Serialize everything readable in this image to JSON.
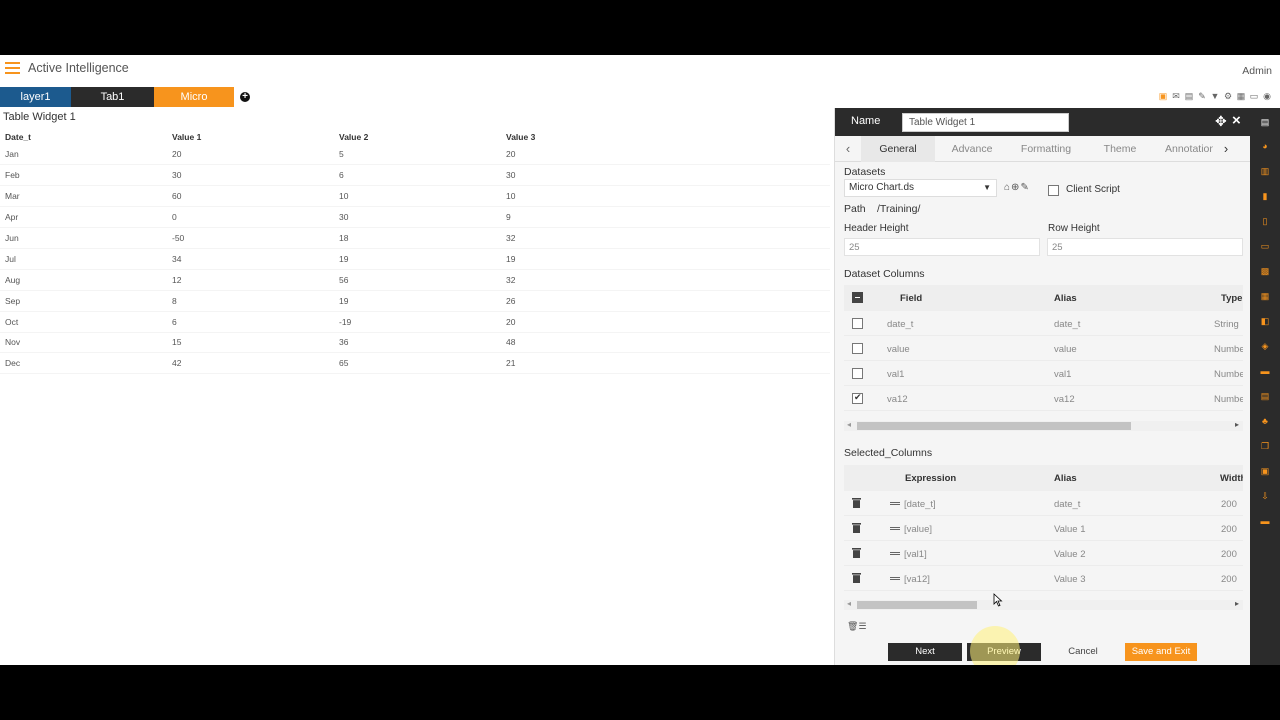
{
  "app": {
    "title": "Active Intelligence",
    "user": "Admin"
  },
  "tabs": [
    {
      "label": "layer1",
      "color": "#1c5a8e"
    },
    {
      "label": "Tab1",
      "color": "#2b2b2b"
    },
    {
      "label": "Micro",
      "color": "#f7941d"
    }
  ],
  "widget": {
    "title": "Table Widget 1",
    "columns": [
      "Date_t",
      "Value 1",
      "Value 2",
      "Value 3"
    ],
    "rows": [
      [
        "Jan",
        "20",
        "5",
        "20"
      ],
      [
        "Feb",
        "30",
        "6",
        "30"
      ],
      [
        "Mar",
        "60",
        "10",
        "10"
      ],
      [
        "Apr",
        "0",
        "30",
        "9"
      ],
      [
        "Jun",
        "-50",
        "18",
        "32"
      ],
      [
        "Jul",
        "34",
        "19",
        "19"
      ],
      [
        "Aug",
        "12",
        "56",
        "32"
      ],
      [
        "Sep",
        "8",
        "19",
        "26"
      ],
      [
        "Oct",
        "6",
        "-19",
        "20"
      ],
      [
        "Nov",
        "15",
        "36",
        "48"
      ],
      [
        "Dec",
        "42",
        "65",
        "21"
      ]
    ]
  },
  "panel": {
    "name_label": "Name",
    "name_value": "Table Widget 1",
    "tabs": [
      "General",
      "Advance",
      "Formatting",
      "Theme",
      "Annotation"
    ],
    "datasets_label": "Datasets",
    "dataset_value": "Micro Chart.ds",
    "client_script_label": "Client Script",
    "path_label": "Path",
    "path_value": "/Training/",
    "header_height_label": "Header Height",
    "header_height_value": "25",
    "row_height_label": "Row Height",
    "row_height_value": "25",
    "dataset_columns_label": "Dataset Columns",
    "dataset_columns_header": {
      "field": "Field",
      "alias": "Alias",
      "type": "Type"
    },
    "dataset_columns": [
      {
        "field": "date_t",
        "alias": "date_t",
        "type": "String",
        "checked": false
      },
      {
        "field": "value",
        "alias": "value",
        "type": "Number",
        "checked": false
      },
      {
        "field": "val1",
        "alias": "val1",
        "type": "Number",
        "checked": false
      },
      {
        "field": "va12",
        "alias": "va12",
        "type": "Number",
        "checked": true
      }
    ],
    "selected_columns_label": "Selected_Columns",
    "selected_columns_header": {
      "expression": "Expression",
      "alias": "Alias",
      "width": "Width"
    },
    "selected_columns": [
      {
        "expression": "[date_t]",
        "alias": "date_t",
        "width": "200"
      },
      {
        "expression": "[value]",
        "alias": "Value 1",
        "width": "200"
      },
      {
        "expression": "[val1]",
        "alias": "Value 2",
        "width": "200"
      },
      {
        "expression": "[va12]",
        "alias": "Value 3",
        "width": "200"
      }
    ],
    "buttons": {
      "next": "Next",
      "preview": "Preview",
      "cancel": "Cancel",
      "save_exit": "Save and Exit"
    }
  },
  "colors": {
    "accent": "#f7941d",
    "dark": "#2b2b2b",
    "tab_blue": "#1c5a8e"
  }
}
